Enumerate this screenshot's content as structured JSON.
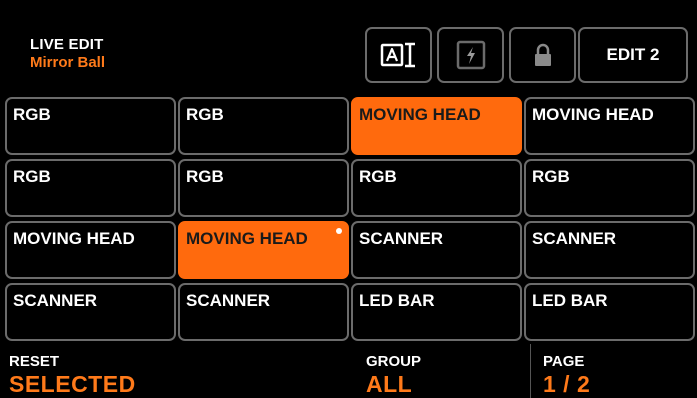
{
  "header": {
    "title": "LIVE EDIT",
    "subtitle": "Mirror Ball",
    "edit_button_label": "EDIT 2",
    "icons": [
      "text-cursor-icon",
      "flash-icon",
      "lock-icon"
    ]
  },
  "grid": {
    "cells": [
      {
        "label": "RGB",
        "selected": false
      },
      {
        "label": "RGB",
        "selected": false
      },
      {
        "label": "MOVING HEAD",
        "selected": true
      },
      {
        "label": "MOVING HEAD",
        "selected": false
      },
      {
        "label": "RGB",
        "selected": false
      },
      {
        "label": "RGB",
        "selected": false
      },
      {
        "label": "RGB",
        "selected": false
      },
      {
        "label": "RGB",
        "selected": false
      },
      {
        "label": "MOVING HEAD",
        "selected": false
      },
      {
        "label": "MOVING HEAD",
        "selected": true,
        "indicator": true
      },
      {
        "label": "SCANNER",
        "selected": false
      },
      {
        "label": "SCANNER",
        "selected": false
      },
      {
        "label": "SCANNER",
        "selected": false
      },
      {
        "label": "SCANNER",
        "selected": false
      },
      {
        "label": "LED BAR",
        "selected": false
      },
      {
        "label": "LED BAR",
        "selected": false
      }
    ]
  },
  "footer": {
    "reset_label": "RESET",
    "reset_value": "SELECTED",
    "group_label": "GROUP",
    "group_value": "ALL",
    "page_label": "PAGE",
    "page_value": "1 / 2"
  },
  "colors": {
    "accent": "#ff6a0d",
    "accent_text": "#ff7a1a",
    "border": "#6b6b6b",
    "background": "#000000"
  }
}
